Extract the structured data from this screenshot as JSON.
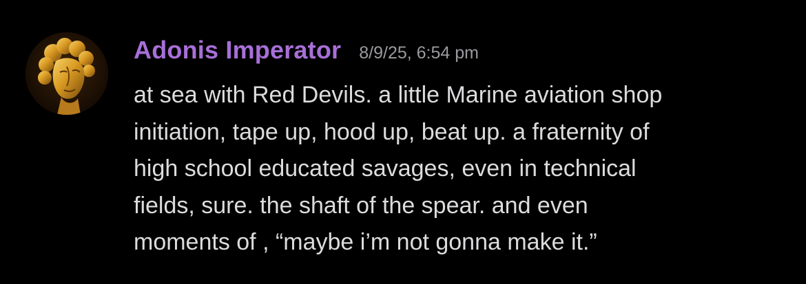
{
  "message": {
    "author": "Adonis Imperator",
    "timestamp": "8/9/25, 6:54 pm",
    "avatar_icon": "golden-bust-avatar",
    "lines": [
      "at sea with Red Devils. a little Marine aviation shop",
      "initiation, tape up, hood up, beat up. a fraternity of",
      "high school educated savages, even in technical",
      "fields, sure. the shaft of the spear. and even",
      "moments of , “maybe i’m not gonna make it.”"
    ]
  },
  "colors": {
    "background": "#000000",
    "username": "#a86fd8",
    "timestamp": "#9a9a9f",
    "body_text": "#dcdcde"
  }
}
